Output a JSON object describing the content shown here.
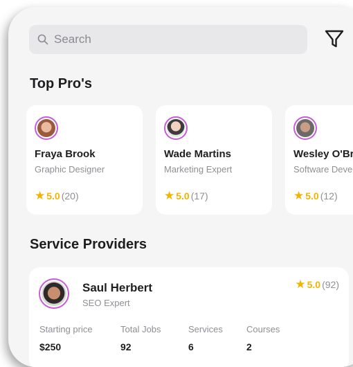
{
  "search": {
    "placeholder": "Search"
  },
  "sections": {
    "top_pros": "Top Pro's",
    "service_providers": "Service Providers"
  },
  "top_pros": [
    {
      "name": "Fraya Brook",
      "role": "Graphic Designer",
      "rating": "5.0",
      "count": "(20)"
    },
    {
      "name": "Wade Martins",
      "role": "Marketing Expert",
      "rating": "5.0",
      "count": "(17)"
    },
    {
      "name": "Wesley O'Brien",
      "role": "Software Developer",
      "rating": "5.0",
      "count": "(12)"
    }
  ],
  "provider": {
    "name": "Saul Herbert",
    "role": "SEO Expert",
    "rating": "5.0",
    "count": "(92)",
    "stats": [
      {
        "label": "Starting price",
        "value": "$250"
      },
      {
        "label": "Total Jobs",
        "value": "92"
      },
      {
        "label": "Services",
        "value": "6"
      },
      {
        "label": "Courses",
        "value": "2"
      }
    ]
  },
  "colors": {
    "star": "#f2b400",
    "avatar_ring": "#c85bd8",
    "background": "#f5f5f6"
  },
  "icons": {
    "search": "search-icon",
    "filter": "filter-icon",
    "star": "star-icon"
  }
}
